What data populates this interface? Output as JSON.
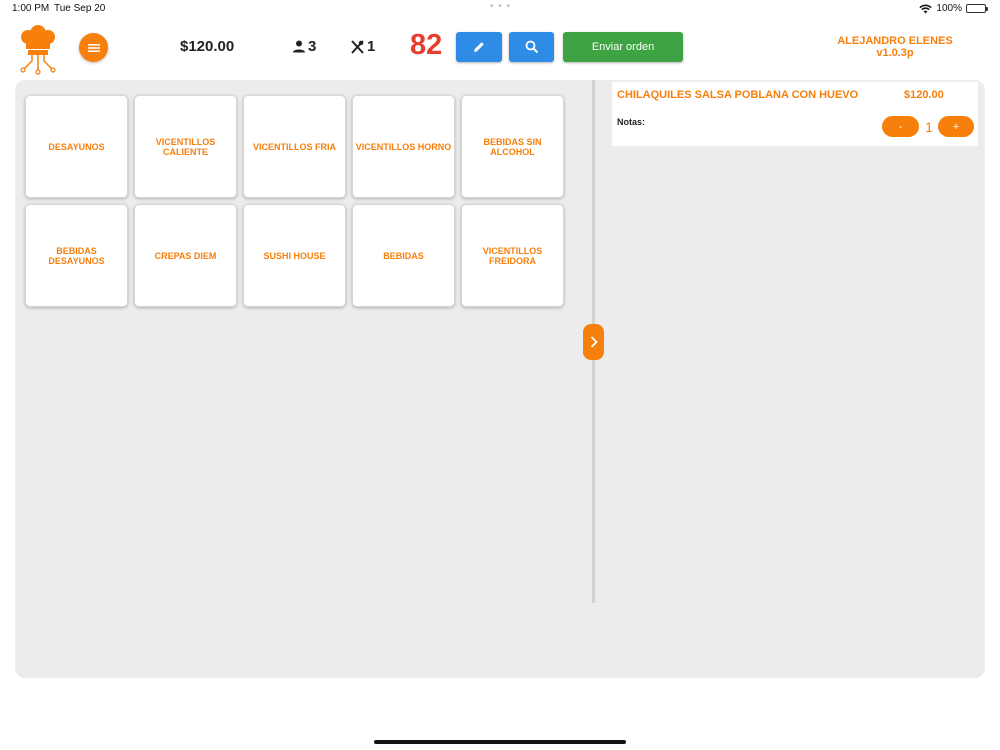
{
  "status_bar": {
    "time": "1:00 PM",
    "date": "Tue Sep 20",
    "battery": "100%"
  },
  "header": {
    "total": "$120.00",
    "guests": "3",
    "tables": "1",
    "order_number": "82",
    "send_label": "Enviar orden",
    "user_name": "ALEJANDRO ELENES",
    "version": "v1.0.3p"
  },
  "categories": [
    {
      "label": "DESAYUNOS"
    },
    {
      "label": "VICENTILLOS CALIENTE"
    },
    {
      "label": "VICENTILLOS FRIA"
    },
    {
      "label": "VICENTILLOS HORNO"
    },
    {
      "label": "BEBIDAS SIN ALCOHOL"
    },
    {
      "label": "BEBIDAS DESAYUNOS"
    },
    {
      "label": "CREPAS DIEM"
    },
    {
      "label": "SUSHI HOUSE"
    },
    {
      "label": "BEBIDAS"
    },
    {
      "label": "VICENTILLOS FREIDORA"
    }
  ],
  "order_items": [
    {
      "name": "CHILAQUILES SALSA POBLANA CON HUEVO",
      "price": "$120.00",
      "notes_label": "Notas:",
      "minus_label": "-",
      "quantity": "1",
      "plus_label": "+"
    }
  ],
  "colors": {
    "accent": "#f77f0c",
    "blue": "#2e8be6",
    "green": "#3ea343",
    "order_number": "#e83e2f"
  }
}
